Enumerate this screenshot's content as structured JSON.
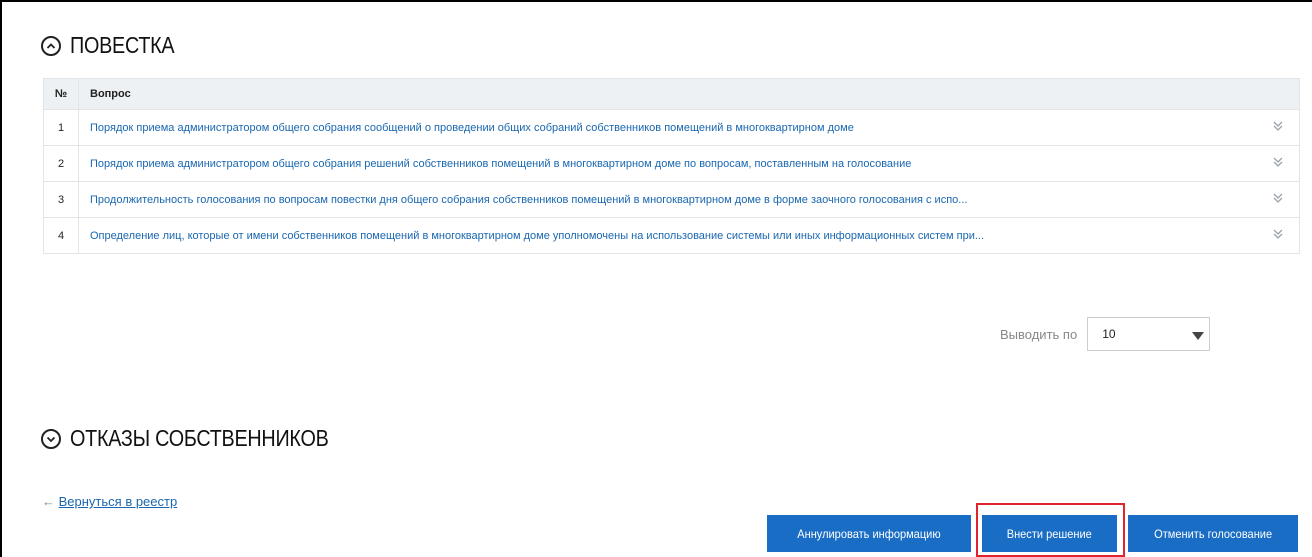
{
  "agenda": {
    "title": "ПОВЕСТКА",
    "columns": {
      "num": "№",
      "question": "Вопрос"
    },
    "rows": [
      {
        "num": "1",
        "question": "Порядок приема администратором общего собрания сообщений о проведении общих собраний собственников помещений в многоквартирном доме"
      },
      {
        "num": "2",
        "question": "Порядок приема администратором общего собрания решений собственников помещений в многоквартирном доме по вопросам, поставленным на голосование"
      },
      {
        "num": "3",
        "question": "Продолжительность голосования по вопросам повестки дня общего собрания собственников помещений в многоквартирном доме в форме заочного голосования с испо..."
      },
      {
        "num": "4",
        "question": "Определение лиц, которые от имени собственников помещений в многоквартирном доме уполномочены на использование системы или иных информационных систем при..."
      }
    ]
  },
  "pager": {
    "label": "Выводить по",
    "value": "10"
  },
  "refusals": {
    "title": "ОТКАЗЫ СОБСТВЕННИКОВ"
  },
  "back": {
    "arrow": "←",
    "link": "Вернуться в реестр"
  },
  "buttons": {
    "annul": "Аннулировать информацию",
    "decision": "Внести решение",
    "cancel_vote": "Отменить голосование"
  },
  "colors": {
    "link": "#1a67b0",
    "button": "#1a6dc5",
    "highlight": "#e0242d",
    "header_bg": "#edf1f4"
  }
}
